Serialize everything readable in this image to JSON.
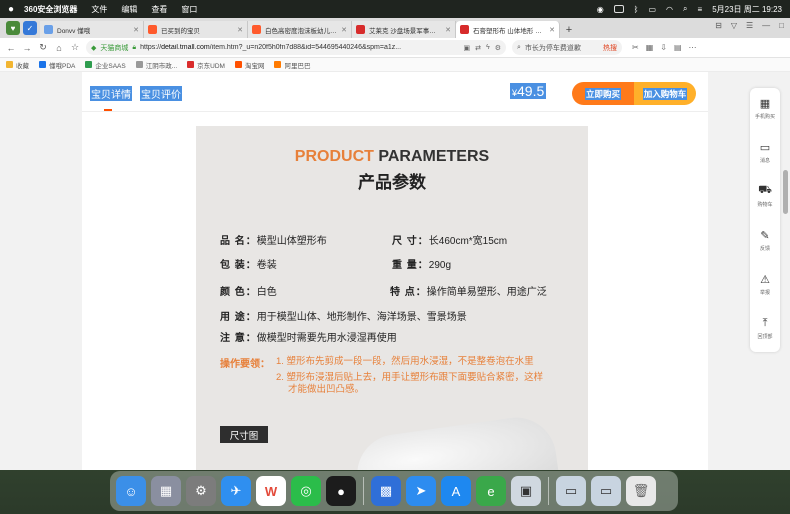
{
  "menubar": {
    "apple": "",
    "app_name": "360安全浏览器",
    "items": [
      "文件",
      "编辑",
      "查看",
      "窗口"
    ],
    "clock": "5月23日 周二  19:23"
  },
  "tabs": [
    {
      "title": "Donvv 懂哦",
      "color": "#6aa0e8",
      "active": false
    },
    {
      "title": "已买到的宝贝",
      "color": "#ff5a2c",
      "active": false
    },
    {
      "title": "白色高密度泡沫板幼儿园环创…",
      "color": "#ff5a2c",
      "active": false
    },
    {
      "title": "艾莱克 沙盘场景军事模型制作…",
      "color": "#d72b2b",
      "active": false
    },
    {
      "title": "石膏塑形布 山体地形 军事沙…",
      "color": "#d72b2b",
      "active": true
    }
  ],
  "toolbar": {
    "site_label": "天猫商城",
    "url_prefix": "https://",
    "url_host": "detail.tmall.com",
    "url_rest": "/item.htm?_u=n20f5h0fn7d88&id=544695440246&spm=a1z...",
    "search_placeholder": "市长为停车费道歉",
    "hot_label": "热搜"
  },
  "bookmarks": [
    {
      "label": "收藏",
      "color": "#f2b531"
    },
    {
      "label": "懂哦PDA",
      "color": "#1a73e8"
    },
    {
      "label": "企业SAAS",
      "color": "#2e9c4e"
    },
    {
      "label": "江阴市政...",
      "color": "#999999"
    },
    {
      "label": "京东UDM",
      "color": "#d92b2b"
    },
    {
      "label": "淘宝网",
      "color": "#ff5000"
    },
    {
      "label": "阿里巴巴",
      "color": "#ff7a00"
    }
  ],
  "product_nav": {
    "tab_detail": "宝贝详情",
    "tab_reviews": "宝贝评价",
    "currency": "¥",
    "price": "49.5",
    "buy_now": "立即购买",
    "add_cart": "加入购物车"
  },
  "poster": {
    "title_orange": "PRODUCT",
    "title_dark": "PARAMETERS",
    "subtitle": "产品参数",
    "specs": [
      {
        "key": "品 名：",
        "value": "模型山体塑形布"
      },
      {
        "key": "尺 寸：",
        "value": "长460cm*宽15cm"
      },
      {
        "key": "包 装：",
        "value": "卷装"
      },
      {
        "key": "重 量：",
        "value": "290g"
      },
      {
        "key": "颜 色：",
        "value": "白色"
      },
      {
        "key": "特 点：",
        "value": "操作简单易塑形、用途广泛"
      },
      {
        "key": "用 途：",
        "value": "用于模型山体、地形制作、海洋场景、雪景场景"
      },
      {
        "key": "注 意：",
        "value": "做模型时需要先用水浸湿再使用"
      }
    ],
    "tips_label": "操作要领：",
    "tip1": "1. 塑形布先剪成一段一段，然后用水浸湿，不是整卷泡在水里",
    "tip2_line1": "2. 塑形布浸湿后贴上去，用手让塑形布跟下面要贴合紧密，这样",
    "tip2_line2": "才能做出凹凸感。",
    "size_chart": "尺寸图"
  },
  "sidebar": [
    {
      "icon": "qr-code-icon",
      "label": "手机购买"
    },
    {
      "icon": "chat-icon",
      "label": "消息"
    },
    {
      "icon": "cart-icon",
      "label": "购物车"
    },
    {
      "icon": "edit-icon",
      "label": "反馈"
    },
    {
      "icon": "warning-icon",
      "label": "举报"
    },
    {
      "icon": "back-to-top-icon",
      "label": "回顶部"
    }
  ],
  "dock": [
    {
      "name": "finder",
      "color": "#3b8fe8"
    },
    {
      "name": "launchpad",
      "color": "#8a8fa0"
    },
    {
      "name": "system-settings",
      "color": "#7c7c7c"
    },
    {
      "name": "safari",
      "color": "#2f8ff0"
    },
    {
      "name": "wps",
      "color": "#e34a3a"
    },
    {
      "name": "wechat",
      "color": "#2bbd4a"
    },
    {
      "name": "qq",
      "color": "#1c1c1c"
    },
    {
      "name": "windows-app",
      "color": "#2f6fd8"
    },
    {
      "name": "feishu",
      "color": "#2d8cf0"
    },
    {
      "name": "app-store",
      "color": "#1e88f0"
    },
    {
      "name": "360-browser",
      "color": "#3aa84a"
    },
    {
      "name": "preview",
      "color": "#d0d8e0"
    },
    {
      "name": "window-1",
      "color": "#c8d4e0"
    },
    {
      "name": "window-2",
      "color": "#c8d4e0"
    },
    {
      "name": "trash",
      "color": "#e8e8e8"
    }
  ]
}
